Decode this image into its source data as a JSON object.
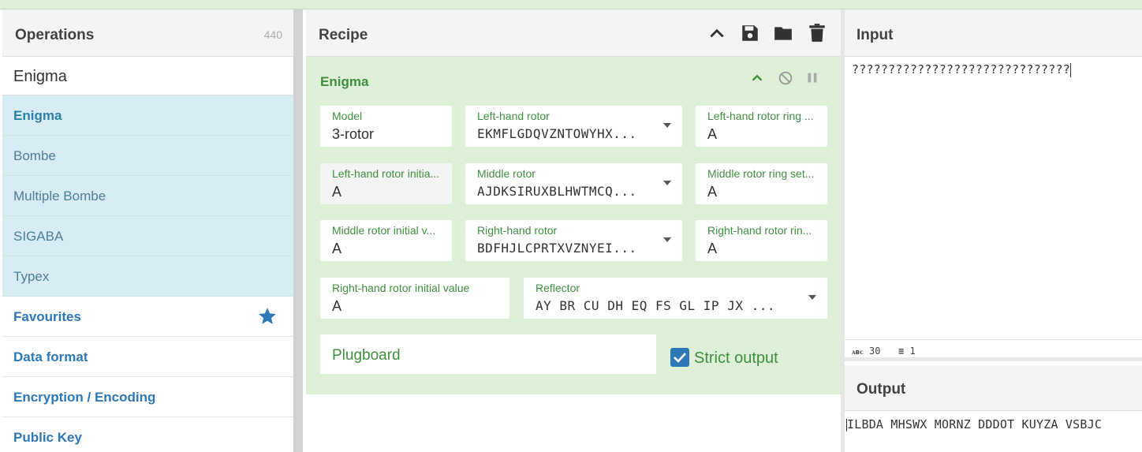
{
  "operations": {
    "title": "Operations",
    "count": "440",
    "search_value": "Enigma",
    "results": [
      "Enigma",
      "Bombe",
      "Multiple Bombe",
      "SIGABA",
      "Typex"
    ],
    "categories": [
      "Favourites",
      "Data format",
      "Encryption / Encoding",
      "Public Key"
    ]
  },
  "recipe": {
    "title": "Recipe",
    "operation": {
      "name": "Enigma",
      "fields": {
        "model": {
          "label": "Model",
          "value": "3-rotor"
        },
        "left_rotor": {
          "label": "Left-hand rotor",
          "value": "EKMFLGDQVZNTOWYHX..."
        },
        "left_ring": {
          "label": "Left-hand rotor ring ...",
          "value": "A"
        },
        "left_initial": {
          "label": "Left-hand rotor initia...",
          "value": "A"
        },
        "middle_rotor": {
          "label": "Middle rotor",
          "value": "AJDKSIRUXBLHWTMCQ..."
        },
        "middle_ring": {
          "label": "Middle rotor ring set...",
          "value": "A"
        },
        "middle_initial": {
          "label": "Middle rotor initial v...",
          "value": "A"
        },
        "right_rotor": {
          "label": "Right-hand rotor",
          "value": "BDFHJLCPRTXVZNYEI..."
        },
        "right_ring": {
          "label": "Right-hand rotor rin...",
          "value": "A"
        },
        "right_initial": {
          "label": "Right-hand rotor initial value",
          "value": "A"
        },
        "reflector": {
          "label": "Reflector",
          "value": "AY BR CU DH EQ FS GL IP JX ..."
        },
        "plugboard": {
          "label": "Plugboard"
        },
        "strict_output": {
          "label": "Strict output",
          "checked": true
        }
      }
    }
  },
  "input": {
    "title": "Input",
    "text": "??????????????????????????????",
    "status_chars": "30",
    "status_lines": "1"
  },
  "output": {
    "title": "Output",
    "text": "ILBDA MHSWX MORNZ DDDOT KUYZA VSBJC"
  },
  "colors": {
    "accent_green": "#3f8f3f",
    "op_bg": "#dff0d8",
    "link_blue": "#2e78b8",
    "result_bg": "#d8ecf4"
  }
}
